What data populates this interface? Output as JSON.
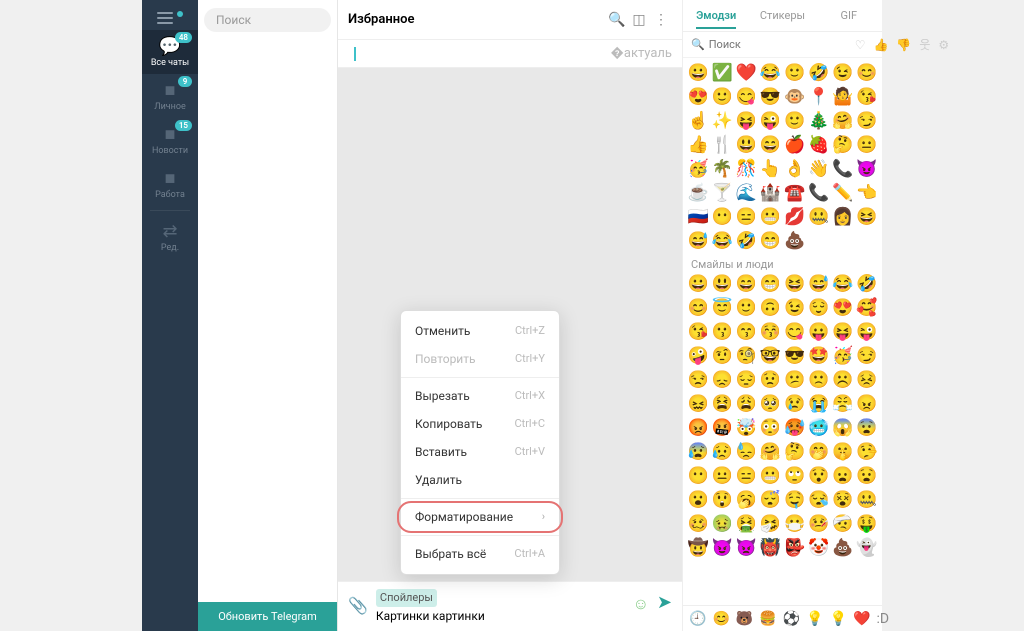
{
  "rail": {
    "items": [
      {
        "label": "Все чаты",
        "badge": "48"
      },
      {
        "label": "Личное",
        "badge": "9"
      },
      {
        "label": "Новости",
        "badge": "15"
      },
      {
        "label": "Работа",
        "badge": ""
      },
      {
        "label": "Ред.",
        "badge": ""
      }
    ]
  },
  "search_placeholder": "Поиск",
  "update_label": "Обновить Telegram",
  "chat": {
    "title": "Избранное",
    "spoiler_tag": "Спойлеры",
    "draft_text": "Картинки картинки"
  },
  "ctx": {
    "undo": {
      "label": "Отменить",
      "sc": "Ctrl+Z"
    },
    "redo": {
      "label": "Повторить",
      "sc": "Ctrl+Y"
    },
    "cut": {
      "label": "Вырезать",
      "sc": "Ctrl+X"
    },
    "copy": {
      "label": "Копировать",
      "sc": "Ctrl+C"
    },
    "paste": {
      "label": "Вставить",
      "sc": "Ctrl+V"
    },
    "delete": {
      "label": "Удалить",
      "sc": ""
    },
    "format": {
      "label": "Форматирование",
      "sc": ""
    },
    "select_all": {
      "label": "Выбрать всё",
      "sc": "Ctrl+A"
    }
  },
  "emoji": {
    "tabs": {
      "emoji": "Эмодзи",
      "stickers": "Стикеры",
      "gif": "GIF"
    },
    "search_placeholder": "Поиск",
    "section_header": "Смайлы и люди",
    "recent": [
      "😀",
      "✅",
      "❤️",
      "😂",
      "🙂",
      "🤣",
      "😉",
      "😊",
      "😍",
      "🙂",
      "😋",
      "😎",
      "🐵",
      "📍",
      "🤷",
      "😘",
      "☝️",
      "✨",
      "😝",
      "😜",
      "🙂",
      "🎄",
      "🤗",
      "😏",
      "👍",
      "🍴",
      "😃",
      "😄",
      "🍎",
      "🍓",
      "🤔",
      "😐",
      "🥳",
      "🌴",
      "🎊",
      "👆",
      "👌",
      "👋",
      "📞",
      "😈",
      "☕",
      "🍸",
      "🌊",
      "🏰",
      "☎️",
      "📞",
      "✏️",
      "👈",
      "🇷🇺",
      "😶",
      "😑",
      "😬",
      "💋",
      "🤐",
      "👩",
      "😆",
      "😅",
      "😂",
      "🤣",
      "😁",
      "💩"
    ],
    "people": [
      "😀",
      "😃",
      "😄",
      "😁",
      "😆",
      "😅",
      "😂",
      "🤣",
      "😊",
      "😇",
      "🙂",
      "🙃",
      "😉",
      "😌",
      "😍",
      "🥰",
      "😘",
      "😗",
      "😙",
      "😚",
      "😋",
      "😛",
      "😝",
      "😜",
      "🤪",
      "🤨",
      "🧐",
      "🤓",
      "😎",
      "🤩",
      "🥳",
      "😏",
      "😒",
      "😞",
      "😔",
      "😟",
      "😕",
      "🙁",
      "☹️",
      "😣",
      "😖",
      "😫",
      "😩",
      "🥺",
      "😢",
      "😭",
      "😤",
      "😠",
      "😡",
      "🤬",
      "🤯",
      "😳",
      "🥵",
      "🥶",
      "😱",
      "😨",
      "😰",
      "😥",
      "😓",
      "🤗",
      "🤔",
      "🤭",
      "🤫",
      "🤥",
      "😶",
      "😐",
      "😑",
      "😬",
      "🙄",
      "😯",
      "😦",
      "😧",
      "😮",
      "😲",
      "🥱",
      "😴",
      "🤤",
      "😪",
      "😵",
      "🤐",
      "🥴",
      "🤢",
      "🤮",
      "🤧",
      "😷",
      "🤒",
      "🤕",
      "🤑",
      "🤠",
      "😈",
      "👿",
      "👹",
      "👺",
      "🤡",
      "💩",
      "👻"
    ],
    "footer": [
      "🕘",
      "😊",
      "🐻",
      "🍔",
      "⚽",
      "💡",
      "💡",
      "❤️",
      ":D"
    ]
  }
}
